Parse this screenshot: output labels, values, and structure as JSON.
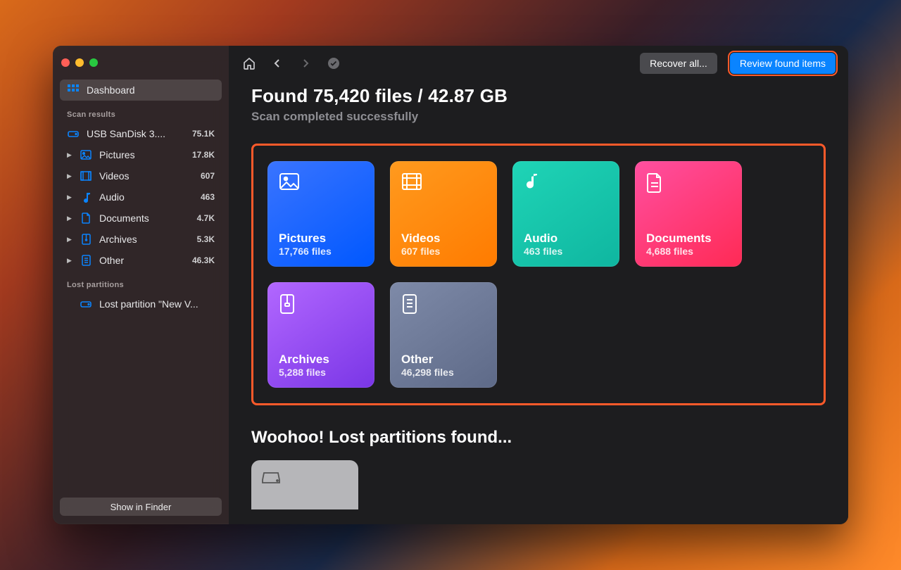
{
  "header": {
    "recover_label": "Recover all...",
    "review_label": "Review found items"
  },
  "summary": {
    "headline": "Found 75,420 files / 42.87 GB",
    "status": "Scan completed successfully"
  },
  "sidebar": {
    "dashboard_label": "Dashboard",
    "scan_results_label": "Scan results",
    "device": {
      "label": "USB  SanDisk 3....",
      "count": "75.1K"
    },
    "items": [
      {
        "label": "Pictures",
        "count": "17.8K"
      },
      {
        "label": "Videos",
        "count": "607"
      },
      {
        "label": "Audio",
        "count": "463"
      },
      {
        "label": "Documents",
        "count": "4.7K"
      },
      {
        "label": "Archives",
        "count": "5.3K"
      },
      {
        "label": "Other",
        "count": "46.3K"
      }
    ],
    "lost_label": "Lost partitions",
    "lost_item": {
      "label": "Lost partition \"New V..."
    },
    "finder_label": "Show in Finder"
  },
  "cards": [
    {
      "name": "Pictures",
      "files": "17,766 files",
      "class": "g-blue",
      "icon": "picture-icon"
    },
    {
      "name": "Videos",
      "files": "607 files",
      "class": "g-orange",
      "icon": "video-icon"
    },
    {
      "name": "Audio",
      "files": "463 files",
      "class": "g-teal",
      "icon": "audio-icon"
    },
    {
      "name": "Documents",
      "files": "4,688 files",
      "class": "g-pink",
      "icon": "document-icon"
    },
    {
      "name": "Archives",
      "files": "5,288 files",
      "class": "g-purple",
      "icon": "archive-icon"
    },
    {
      "name": "Other",
      "files": "46,298 files",
      "class": "g-slate",
      "icon": "other-icon"
    }
  ],
  "partitions": {
    "headline": "Woohoo! Lost partitions found..."
  }
}
